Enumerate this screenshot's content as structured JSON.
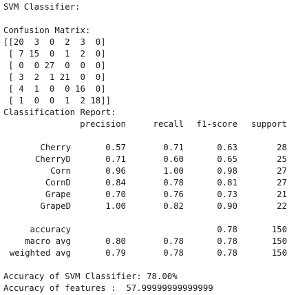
{
  "header": "SVM Classifier:",
  "confusion_title": "Confusion Matrix:",
  "matrix_lines": [
    "[[20  3  0  2  3  0]",
    " [ 7 15  0  1  2  0]",
    " [ 0  0 27  0  0  0]",
    " [ 3  2  1 21  0  0]",
    " [ 4  1  0  0 16  0]",
    " [ 1  0  0  1  2 18]]"
  ],
  "report_title": "Classification Report:",
  "report_headers": [
    "precision",
    "recall",
    "f1-score",
    "support"
  ],
  "class_rows": [
    {
      "label": "Cherry",
      "precision": "0.57",
      "recall": "0.71",
      "f1": "0.63",
      "support": "28"
    },
    {
      "label": "CherryD",
      "precision": "0.71",
      "recall": "0.60",
      "f1": "0.65",
      "support": "25"
    },
    {
      "label": "Corn",
      "precision": "0.96",
      "recall": "1.00",
      "f1": "0.98",
      "support": "27"
    },
    {
      "label": "CornD",
      "precision": "0.84",
      "recall": "0.78",
      "f1": "0.81",
      "support": "27"
    },
    {
      "label": "Grape",
      "precision": "0.70",
      "recall": "0.76",
      "f1": "0.73",
      "support": "21"
    },
    {
      "label": "GrapeD",
      "precision": "1.00",
      "recall": "0.82",
      "f1": "0.90",
      "support": "22"
    }
  ],
  "summary_rows": [
    {
      "label": "accuracy",
      "precision": "",
      "recall": "",
      "f1": "0.78",
      "support": "150"
    },
    {
      "label": "macro avg",
      "precision": "0.80",
      "recall": "0.78",
      "f1": "0.78",
      "support": "150"
    },
    {
      "label": "weighted avg",
      "precision": "0.79",
      "recall": "0.78",
      "f1": "0.78",
      "support": "150"
    }
  ],
  "accuracy_line": "Accuracy of SVM Classifier: 78.00%",
  "features_line": "Accuracy of features :  57.99999999999999"
}
